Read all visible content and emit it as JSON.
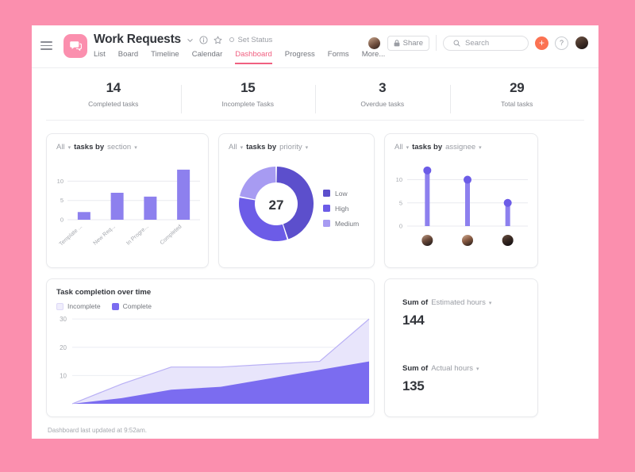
{
  "theme": {
    "page_bg": "#fb8fae",
    "brand_pink": "#fb8fae",
    "accent_tab": "#f06080",
    "purple_dark": "#5c4fcc",
    "purple_mid": "#6c5ce7",
    "purple_light": "#a79bf2",
    "purple_pale": "#e7e4fb",
    "plus_orange": "#fb7252"
  },
  "header": {
    "project_title": "Work Requests",
    "menu_icon": "hamburger-icon",
    "logo_icon": "chat-bubble-icon",
    "title_chevron_icon": "chevron-down-icon",
    "info_icon": "info-circle-icon",
    "star_icon": "star-icon",
    "set_status_label": "Set Status",
    "tabs": [
      {
        "label": "List",
        "active": false
      },
      {
        "label": "Board",
        "active": false
      },
      {
        "label": "Timeline",
        "active": false
      },
      {
        "label": "Calendar",
        "active": false
      },
      {
        "label": "Dashboard",
        "active": true
      },
      {
        "label": "Progress",
        "active": false
      },
      {
        "label": "Forms",
        "active": false
      },
      {
        "label": "More...",
        "active": false
      }
    ],
    "share_label": "Share",
    "share_icon": "lock-icon",
    "search_placeholder": "Search",
    "search_icon": "search-icon",
    "plus_label": "+",
    "help_label": "?"
  },
  "stats": [
    {
      "value": "14",
      "label": "Completed tasks"
    },
    {
      "value": "15",
      "label": "Incomplete Tasks"
    },
    {
      "value": "3",
      "label": "Overdue tasks"
    },
    {
      "value": "29",
      "label": "Total tasks"
    }
  ],
  "widgets": {
    "section": {
      "scope": "All",
      "prefix": "tasks by",
      "field": "section"
    },
    "priority": {
      "scope": "All",
      "prefix": "tasks by",
      "field": "priority"
    },
    "assignee": {
      "scope": "All",
      "prefix": "tasks by",
      "field": "assignee"
    },
    "over_time_title": "Task completion over time",
    "legend": [
      {
        "label": "Incomplete",
        "color": "#e7e4fb"
      },
      {
        "label": "Complete",
        "color": "#6c5ce7"
      }
    ]
  },
  "sums": [
    {
      "prefix": "Sum of",
      "field": "Estimated hours",
      "value": "144"
    },
    {
      "prefix": "Sum of",
      "field": "Actual hours",
      "value": "135"
    }
  ],
  "footer": {
    "note": "Dashboard last updated at 9:52am."
  },
  "chart_data": [
    {
      "type": "bar",
      "title": "tasks by section",
      "categories": [
        "Template ...",
        "New Req...",
        "In Progre...",
        "Completed"
      ],
      "values": [
        2,
        7,
        6,
        13
      ],
      "ylabel": "",
      "xlabel": "",
      "yticks": [
        0,
        5,
        10
      ],
      "ylim": [
        0,
        14
      ],
      "grid": true,
      "color": "#8d80ee"
    },
    {
      "type": "pie",
      "title": "tasks by priority",
      "center_label": "27",
      "labels": [
        "Low",
        "High",
        "Medium"
      ],
      "values": [
        45,
        33,
        22
      ],
      "colors": [
        "#5c4fcc",
        "#6c5ce7",
        "#a79bf2"
      ],
      "legend_position": "right",
      "donut": true
    },
    {
      "type": "scatter",
      "title": "tasks by assignee",
      "categories": [
        "assignee-1",
        "assignee-2",
        "assignee-3"
      ],
      "values": [
        12,
        10,
        5
      ],
      "yticks": [
        0,
        5,
        10
      ],
      "ylim": [
        0,
        13
      ],
      "grid": true,
      "color": "#8d80ee",
      "style": "lollipop"
    },
    {
      "type": "area",
      "title": "Task completion over time",
      "x": [
        0,
        1,
        2,
        3,
        4,
        5,
        6
      ],
      "series": [
        {
          "name": "Complete",
          "values": [
            0,
            2,
            5,
            6,
            9,
            12,
            15
          ],
          "color": "#6c5ce7"
        },
        {
          "name": "Incomplete",
          "values": [
            0,
            5,
            8,
            7,
            5,
            3,
            15
          ],
          "color": "#e7e4fb"
        }
      ],
      "yticks": [
        10,
        20,
        30
      ],
      "ylim": [
        0,
        32
      ],
      "stacked": true,
      "grid": true
    }
  ]
}
